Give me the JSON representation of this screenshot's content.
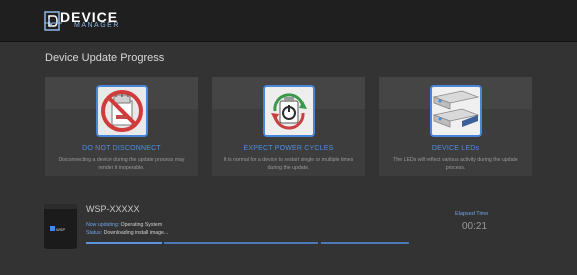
{
  "app": {
    "logo_main": "DEVICE",
    "logo_sub": "MANAGER"
  },
  "page": {
    "title": "Device Update Progress"
  },
  "cards": [
    {
      "title": "DO NOT DISCONNECT",
      "description": "Disconnecting a device during the update process may render it inoperable.",
      "icon": "no-unplug-icon"
    },
    {
      "title": "EXPECT POWER CYCLES",
      "description": "It is normal for a device to restart single or multiple times during the update.",
      "icon": "power-cycle-icon"
    },
    {
      "title": "DEVICE LEDs",
      "description": "The LEDs will reflect various activity during the update process.",
      "icon": "device-leds-icon"
    }
  ],
  "device": {
    "name": "WSP-XXXXX",
    "badge": "WSP",
    "now_updating_label": "Now updating:",
    "now_updating_value": "Operating System",
    "status_label": "Status:",
    "status_value": "Downloading install image..."
  },
  "elapsed": {
    "label": "Elapsed Time",
    "value": "00:21"
  },
  "colors": {
    "accent": "#4d8fe0",
    "background": "#333333",
    "topbar": "#1f1f1f"
  }
}
